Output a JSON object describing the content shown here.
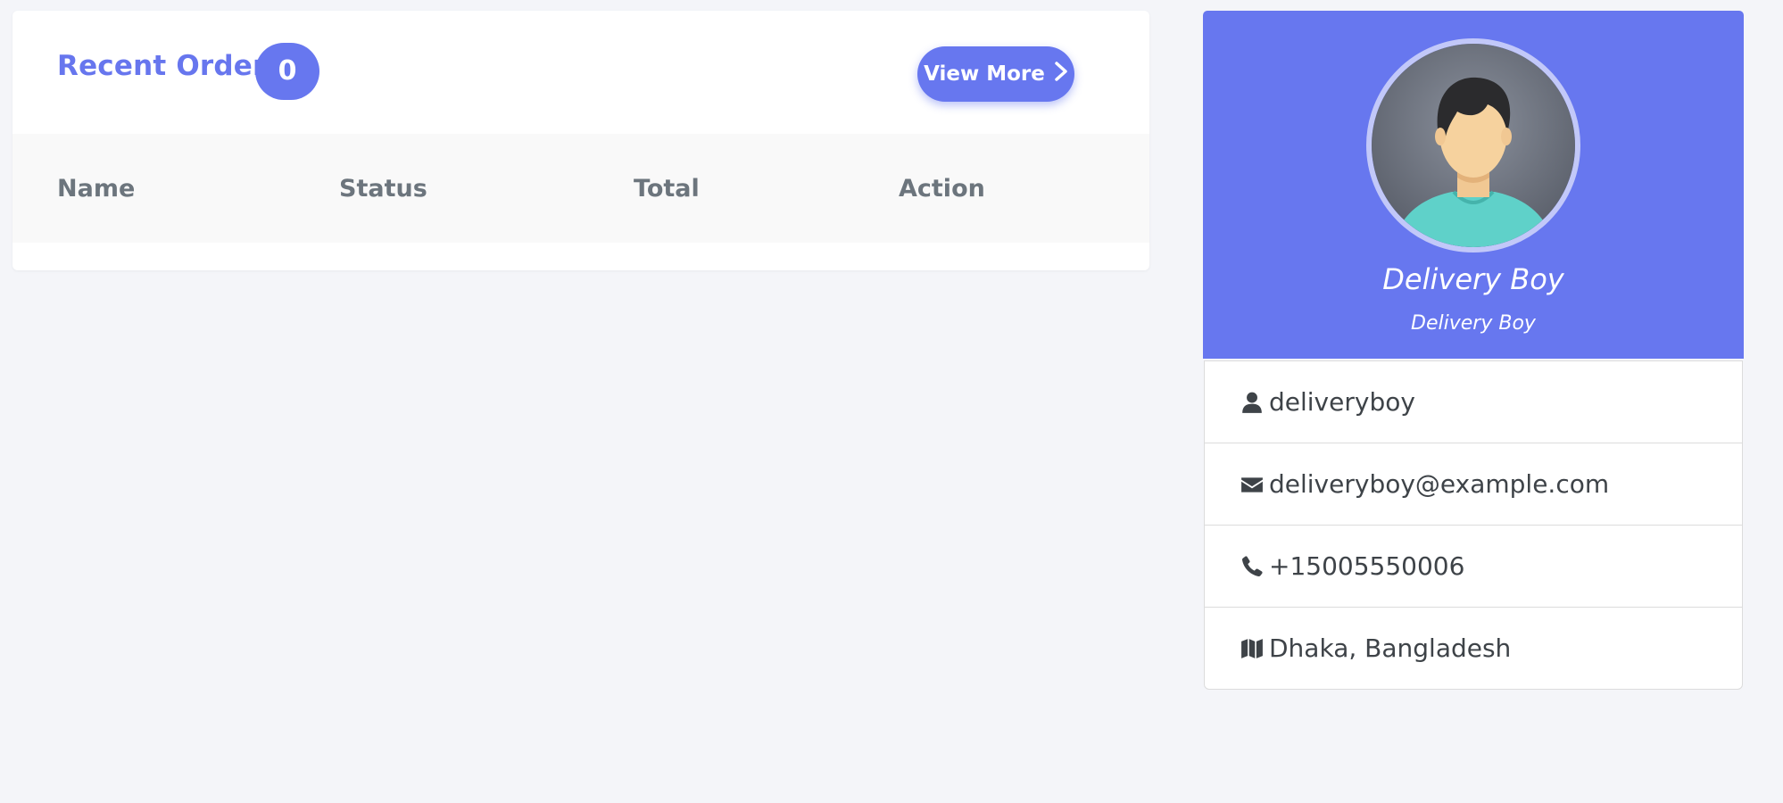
{
  "orders": {
    "title": "Recent Orders",
    "count": "0",
    "view_more_label": "View More",
    "columns": [
      "Name",
      "Status",
      "Total",
      "Action"
    ]
  },
  "profile": {
    "name": "Delivery Boy",
    "role": "Delivery Boy",
    "details": [
      {
        "icon": "user-icon",
        "text": "deliveryboy"
      },
      {
        "icon": "envelope-icon",
        "text": "deliveryboy@example.com"
      },
      {
        "icon": "phone-icon",
        "text": "+15005550006"
      },
      {
        "icon": "map-icon",
        "text": "Dhaka, Bangladesh"
      }
    ]
  },
  "colors": {
    "accent": "#6777ef",
    "background": "#f4f5f9",
    "text": "#3e4348",
    "muted": "#6c757d"
  }
}
